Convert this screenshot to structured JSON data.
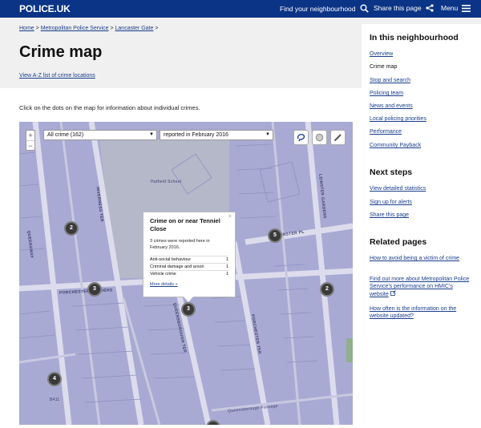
{
  "header": {
    "logo": "POLICE.UK",
    "find_neighbourhood": "Find your neighbourhood",
    "share": "Share this page",
    "menu": "Menu"
  },
  "breadcrumb": {
    "home": "Home",
    "force": "Metropolitan Police Service",
    "area": "Lancaster Gate",
    "sep": ">"
  },
  "page": {
    "title": "Crime map",
    "az_link": "View A-Z list of crime locations",
    "intro": "Click on the dots on the map for information about individual crimes."
  },
  "map": {
    "zoom_in": "+",
    "zoom_out": "−",
    "crime_select": "All crime (162)",
    "date_select": "reported in February 2016",
    "clusters": [
      "2",
      "3",
      "3",
      "5",
      "2",
      "4"
    ],
    "labels": {
      "school": "Hatfield School",
      "inverness_terr": "INVERNESS TER",
      "queensway": "QUEENSWAY",
      "porchester": "PORCHESTER GARDENS",
      "queensborough": "QUEENSBOROUGH TER",
      "leinster": "LEINSTER GARDENS",
      "porchester_ter": "PORCHESTER TER",
      "leinster_pl": "LEINSTER PL",
      "passage": "Queensborough Passage",
      "b411": "B411"
    },
    "popup": {
      "title": "Crime on or near Tenniel Close",
      "text": "3 crimes were reported here in February 2016.",
      "rows": [
        {
          "label": "Anti-social behaviour",
          "count": "1"
        },
        {
          "label": "Criminal damage and arson",
          "count": "1"
        },
        {
          "label": "Vehicle crime",
          "count": "1"
        }
      ],
      "more": "More details »",
      "close": "×"
    }
  },
  "sidebar": {
    "neighbourhood_title": "In this neighbourhood",
    "neighbourhood_items": [
      "Overview",
      "Crime map",
      "Stop and search",
      "Policing team",
      "News and events",
      "Local policing priorities",
      "Performance",
      "Community Payback"
    ],
    "next_title": "Next steps",
    "next_items": [
      "View detailed statistics",
      "Sign up for alerts",
      "Share this page"
    ],
    "related_title": "Related pages",
    "related_items": [
      "How to avoid being a victim of crime",
      "Find out more about Metropolitan Police Service's performance on HMIC's website",
      "How often is the information on the website updated?"
    ]
  },
  "colors": {
    "header_bg": "#0b3486",
    "link": "#1a3e8c",
    "map_bg": "#a8aad4",
    "cluster": "#3a3a3a"
  }
}
